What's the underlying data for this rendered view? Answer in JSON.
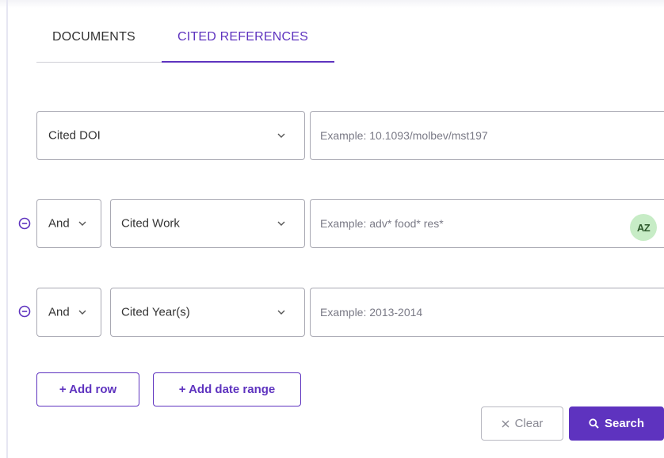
{
  "tabs": [
    {
      "label": "DOCUMENTS",
      "active": false
    },
    {
      "label": "CITED REFERENCES",
      "active": true
    }
  ],
  "rows": [
    {
      "field": "Cited DOI",
      "placeholder": "Example: 10.1093/molbev/mst197"
    },
    {
      "operator": "And",
      "field": "Cited Work",
      "placeholder": "Example: adv* food* res*",
      "badge": "AZ"
    },
    {
      "operator": "And",
      "field": "Cited Year(s)",
      "placeholder": "Example: 2013-2014"
    }
  ],
  "actions": {
    "add_row": "+ Add row",
    "add_date_range": "+ Add date range",
    "clear": "Clear",
    "search": "Search"
  },
  "icons": {
    "remove_row": "minus-circle-icon",
    "dropdown": "chevron-down-icon",
    "az_index": "a-z-index-icon",
    "clear": "close-icon",
    "search": "search-icon"
  },
  "colors": {
    "accent": "#5e33bf",
    "badge_bg": "#c7ecc6",
    "border": "#a9a9b3"
  }
}
